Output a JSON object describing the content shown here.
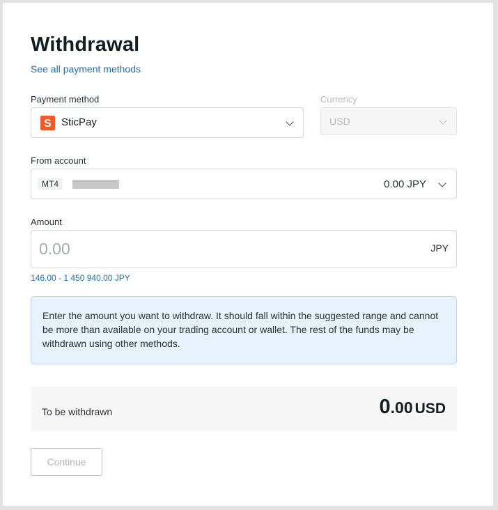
{
  "page": {
    "title": "Withdrawal",
    "see_all_link": "See all payment methods"
  },
  "payment_method": {
    "label": "Payment method",
    "value": "SticPay",
    "logo_letter": "S",
    "logo_color": "#f05a28"
  },
  "currency": {
    "label": "Currency",
    "value": "USD"
  },
  "from_account": {
    "label": "From account",
    "platform": "MT4",
    "balance": "0.00 JPY"
  },
  "amount": {
    "label": "Amount",
    "placeholder": "0.00",
    "unit": "JPY",
    "range": "146.00 - 1 450 940.00 JPY"
  },
  "info_text": "Enter the amount you want to withdraw. It should fall within the suggested range and cannot be more than available on your trading account or wallet. The rest of the funds may be withdrawn using other methods.",
  "summary": {
    "label": "To be withdrawn",
    "amount_int": "0",
    "amount_dec": ".00",
    "currency": "USD"
  },
  "continue_label": "Continue",
  "colors": {
    "link": "#1f6fb2",
    "info_bg": "#e8f2fc",
    "brand_sticpay": "#f05a28"
  }
}
